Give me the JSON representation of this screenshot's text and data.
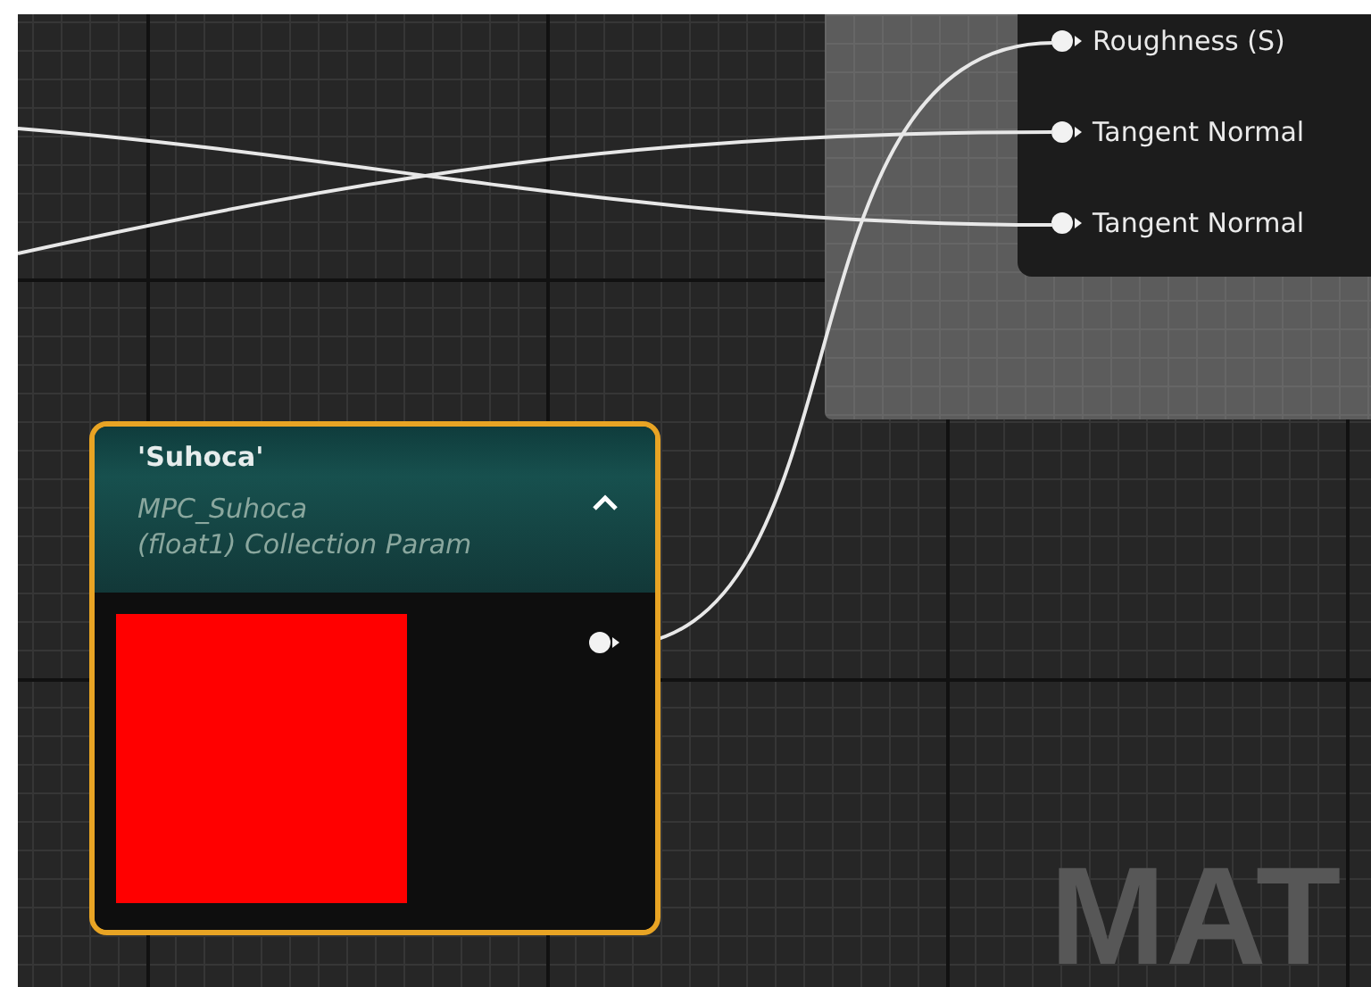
{
  "result_node": {
    "pins": [
      {
        "label": "Roughness (S)"
      },
      {
        "label": "Tangent Normal"
      },
      {
        "label": "Tangent Normal"
      }
    ]
  },
  "parameter_node": {
    "title": "'Suhoca'",
    "subtitle_lines": [
      "MPC_Suhoca",
      "(float1) Collection Param"
    ],
    "expanded": true,
    "selected": true
  },
  "graph_label": "MAT"
}
